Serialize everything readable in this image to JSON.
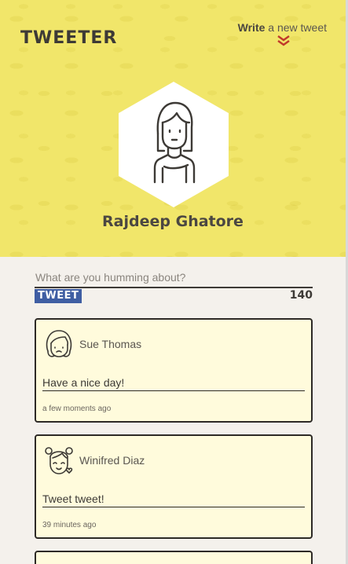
{
  "app": {
    "logo": "TWEETER"
  },
  "header": {
    "write_bold": "Write",
    "write_rest": "a new tweet",
    "user_name": "Rajdeep Ghatore"
  },
  "compose": {
    "placeholder": "What are you humming about?",
    "button_label": "TWEET",
    "char_count": "140"
  },
  "tweets": [
    {
      "author": "Sue Thomas",
      "text": "Have a nice day!",
      "time": "a few moments ago"
    },
    {
      "author": "Winifred Diaz",
      "text": "Tweet tweet!",
      "time": "39 minutes ago"
    }
  ],
  "colors": {
    "header_bg": "#f1e66a",
    "page_bg": "#f4f1ec",
    "card_bg": "#fffbdc",
    "button_bg": "#3f5ea3",
    "chevron": "#c0392b",
    "text_dark": "#3d3a36"
  },
  "icons": {
    "write": "double-chevron-down-icon",
    "profile": "woman-avatar-icon",
    "tweet_avatar_1": "girl-avatar-icon",
    "tweet_avatar_2": "girl-pigtails-avatar-icon"
  }
}
